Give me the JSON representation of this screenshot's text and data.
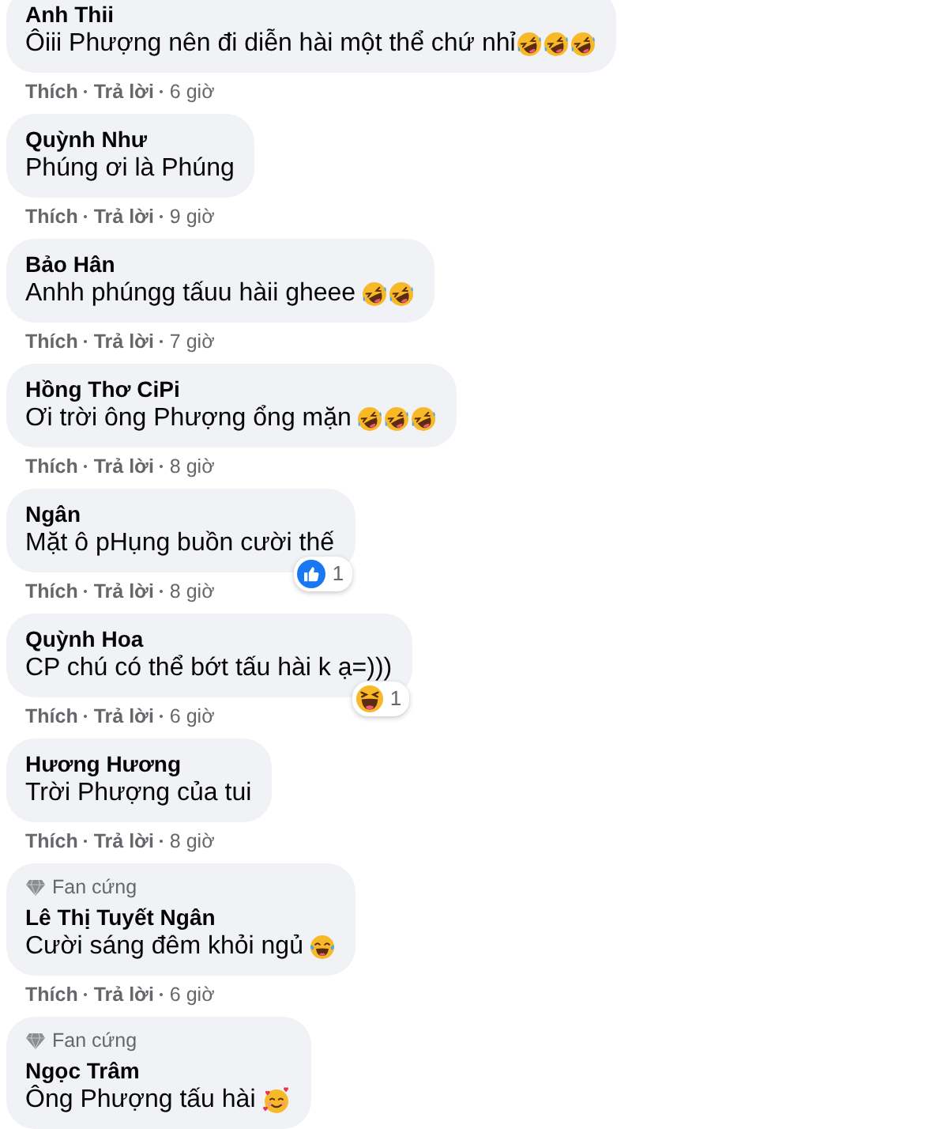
{
  "comments": [
    {
      "name": "Anh Thii",
      "text": "Ôiii Phượng nên đi diễn hài một thể chứ nhỉ",
      "emojis": [
        {
          "kind": "rofl"
        },
        {
          "kind": "rofl"
        },
        {
          "kind": "rofl"
        }
      ],
      "like": "Thích",
      "reply": "Trả lời",
      "time": "6 giờ"
    },
    {
      "name": "Quỳnh Như",
      "text": "Phúng ơi là Phúng",
      "like": "Thích",
      "reply": "Trả lời",
      "time": "9 giờ"
    },
    {
      "name": "Bảo Hân",
      "text": "Anhh phúngg tấuu hàii gheee",
      "emojis": [
        {
          "kind": "rofl"
        },
        {
          "kind": "rofl"
        }
      ],
      "like": "Thích",
      "reply": "Trả lời",
      "time": "7 giờ"
    },
    {
      "name": "Hồng Thơ CiPi",
      "text": "Ơi trời ông Phượng ổng mặn",
      "emojis": [
        {
          "kind": "rofl"
        },
        {
          "kind": "rofl"
        },
        {
          "kind": "rofl"
        }
      ],
      "like": "Thích",
      "reply": "Trả lời",
      "time": "8 giờ"
    },
    {
      "name": "Ngân",
      "text": "Mặt ô pHụng buồn cười thế",
      "reaction": {
        "kind": "like",
        "count": "1"
      },
      "like": "Thích",
      "reply": "Trả lời",
      "time": "8 giờ"
    },
    {
      "name": "Quỳnh Hoa",
      "text": "CP chú có thể bớt tấu hài k ạ=)))",
      "reaction": {
        "kind": "haha",
        "count": "1"
      },
      "like": "Thích",
      "reply": "Trả lời",
      "time": "6 giờ"
    },
    {
      "name": "Hương Hương",
      "text": "Trời Phượng của tui",
      "like": "Thích",
      "reply": "Trả lời",
      "time": "8 giờ"
    },
    {
      "badge": "Fan cứng",
      "name": "Lê Thị Tuyết Ngân",
      "text": "Cười sáng đêm khỏi ngủ",
      "emojis": [
        {
          "kind": "joy"
        }
      ],
      "like": "Thích",
      "reply": "Trả lời",
      "time": "6 giờ"
    },
    {
      "badge": "Fan cứng",
      "name": "Ngọc Trâm",
      "text": "Ông Phượng tấu hài",
      "emojis": [
        {
          "kind": "hearts"
        }
      ]
    }
  ]
}
